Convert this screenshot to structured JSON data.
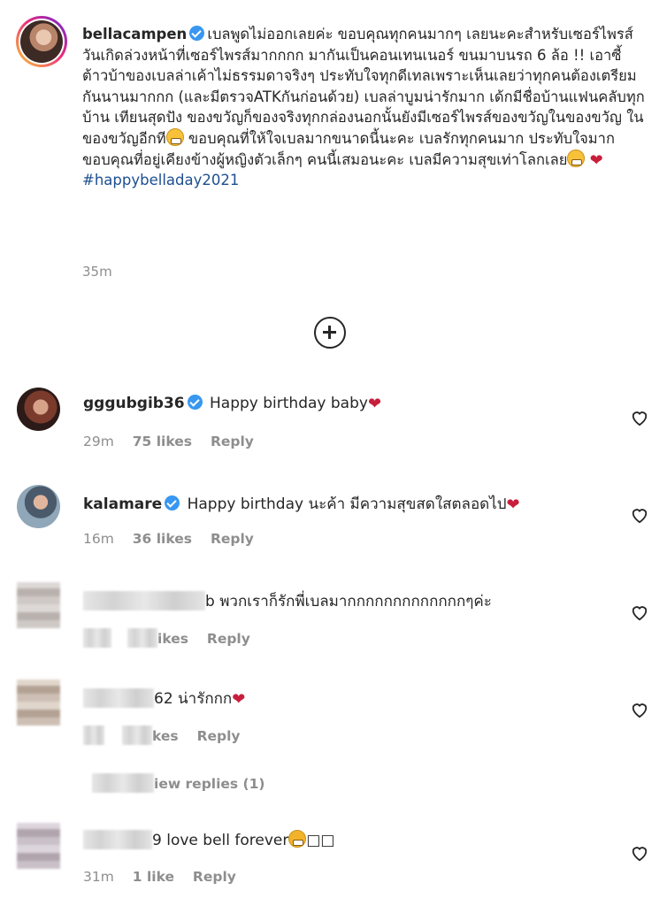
{
  "caption": {
    "username": "bellacampen",
    "text": "เบลพูดไม่ออกเลยค่ะ ขอบคุณทุกคนมากๆ เลยนะคะสำหรับเซอร์ไพรส์วันเกิดล่วงหน้าที่เซอร์ไพรส์มากกกก มากันเป็นคอนเทนเนอร์ ขนมาบนรถ 6 ล้อ !! เอาซี้ ต้าวบ้าของเบลล่าเค้าไม่ธรรมดาจริงๆ ประทับใจทุกดีเทลเพราะเห็นเลยว่าทุกคนต้องเตรียมกันนานมากกก (และมีตรวจATKกันก่อนด้วย) เบลล่าบูมน่ารักมาก เด้กมีชื่อบ้านแฟนคลับทุกบ้าน เทียนสุดปัง ของขวัญก็ของจริงทุกกล่องนอกนั้นยังมีเซอร์ไพรส์ของขวัญในของขวัญ ในของขวัญอีกที",
    "text_part2": " ขอบคุณที่ให้ใจเบลมากขนาดนี้นะคะ เบลรักทุกคนมาก ประทับใจมาก ขอบคุณที่อยู่เคียงข้างผู้หญิงตัวเล็กๆ คนนี้เสมอนะคะ เบลมีความสุขเท่าโลกเลย",
    "hashtag": "#happybelladay2021",
    "time": "35m"
  },
  "load_more": {
    "icon": "plus-circle-icon"
  },
  "comments": [
    {
      "username": "gggubgib36",
      "verified": true,
      "text": "Happy birthday baby",
      "time": "29m",
      "likes": "75 likes",
      "reply": "Reply"
    },
    {
      "username": "kalamare",
      "verified": true,
      "text": "Happy birthday นะค้า มีความสุขสดใสตลอดไป",
      "time": "16m",
      "likes": "36 likes",
      "reply": "Reply"
    },
    {
      "username_tail": "b",
      "text": "พวกเราก็รักพี่เบลมากกกกกกกกกกกกกๆค่ะ",
      "likes_tail": "ikes",
      "reply": "Reply"
    },
    {
      "username_tail": "62",
      "text": "น่ารักกก",
      "likes_tail": "kes",
      "reply": "Reply",
      "view_replies_tail": "iew replies (1)"
    },
    {
      "username_tail": "9",
      "text": "love bell forever",
      "trailing": "□□",
      "time": "31m",
      "likes": "1 like",
      "reply": "Reply"
    }
  ]
}
